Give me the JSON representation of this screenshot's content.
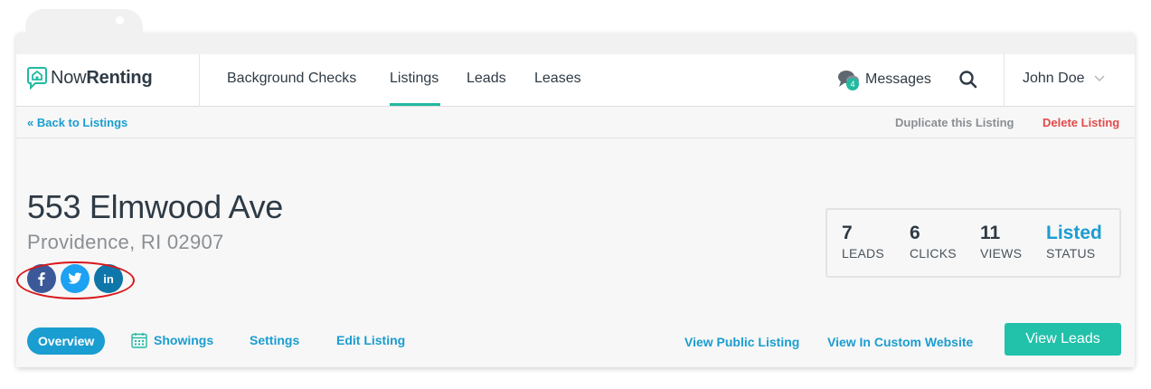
{
  "brand": {
    "name_part1": "Now",
    "name_part2": "Renting",
    "accent": "#22b9a2"
  },
  "nav": {
    "items": [
      {
        "label": "Background Checks"
      },
      {
        "label": "Listings",
        "active": true
      },
      {
        "label": "Leads"
      },
      {
        "label": "Leases"
      }
    ],
    "messages_label": "Messages",
    "messages_count": "4",
    "user_name": "John Doe"
  },
  "subbar": {
    "back_label": "« Back to Listings",
    "duplicate_label": "Duplicate this Listing",
    "delete_label": "Delete Listing"
  },
  "listing": {
    "address": "553 Elmwood Ave",
    "city": "Providence, RI 02907",
    "social": [
      {
        "icon": "facebook-icon",
        "glyph": "f"
      },
      {
        "icon": "twitter-icon",
        "glyph": "t"
      },
      {
        "icon": "linkedin-icon",
        "glyph": "in"
      }
    ]
  },
  "stats": {
    "leads": {
      "value": "7",
      "label": "LEADS"
    },
    "clicks": {
      "value": "6",
      "label": "CLICKS"
    },
    "views": {
      "value": "11",
      "label": "VIEWS"
    },
    "status": {
      "value": "Listed",
      "label": "STATUS"
    }
  },
  "tabs": {
    "overview": "Overview",
    "showings": "Showings",
    "settings": "Settings",
    "edit": "Edit Listing",
    "view_public": "View Public Listing",
    "view_custom": "View In Custom Website",
    "view_leads": "View Leads"
  },
  "colors": {
    "link": "#1a9dd0",
    "danger": "#e24b4b",
    "teal_button": "#22c1aa",
    "text": "#2e3a45"
  }
}
